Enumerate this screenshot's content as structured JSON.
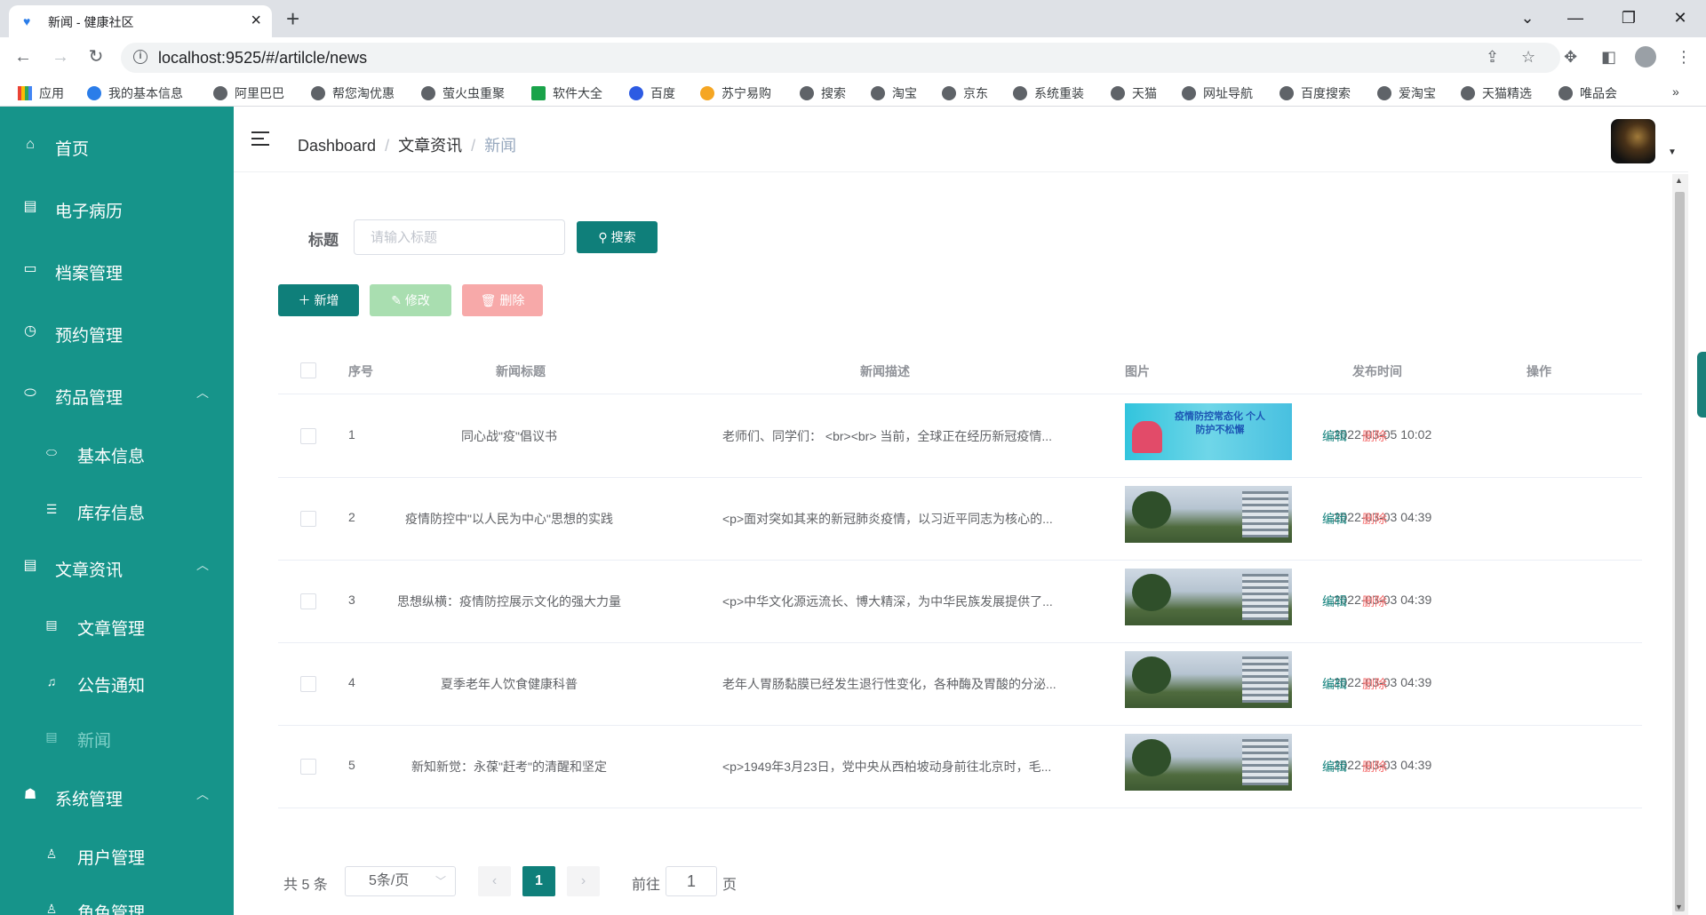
{
  "browser": {
    "tab_title": "新闻 - 健康社区",
    "url": "localhost:9525/#/artilcle/news",
    "bookmarks": [
      "应用",
      "我的基本信息",
      "阿里巴巴",
      "帮您淘优惠",
      "萤火虫重聚",
      "软件大全",
      "百度",
      "苏宁易购",
      "搜索",
      "淘宝",
      "京东",
      "系统重装",
      "天猫",
      "网址导航",
      "百度搜索",
      "爱淘宝",
      "天猫精选",
      "唯品会"
    ]
  },
  "sidebar": {
    "items": [
      {
        "label": "首页",
        "icon": "home-icon"
      },
      {
        "label": "电子病历",
        "icon": "record-icon"
      },
      {
        "label": "档案管理",
        "icon": "folder-icon"
      },
      {
        "label": "预约管理",
        "icon": "clock-icon"
      },
      {
        "label": "药品管理",
        "icon": "pill-icon"
      },
      {
        "label": "基本信息",
        "icon": "pill-icon"
      },
      {
        "label": "库存信息",
        "icon": "database-icon"
      },
      {
        "label": "文章资讯",
        "icon": "article-icon"
      },
      {
        "label": "文章管理",
        "icon": "document-icon"
      },
      {
        "label": "公告通知",
        "icon": "bell-icon"
      },
      {
        "label": "新闻",
        "icon": "document-icon"
      },
      {
        "label": "系统管理",
        "icon": "user-group-icon"
      },
      {
        "label": "用户管理",
        "icon": "user-icon"
      },
      {
        "label": "角色管理",
        "icon": "roles-icon"
      }
    ]
  },
  "header": {
    "breadcrumb": [
      "Dashboard",
      "文章资讯",
      "新闻"
    ]
  },
  "search": {
    "label": "标题",
    "placeholder": "请输入标题",
    "value": "",
    "button": "搜索"
  },
  "toolbar": {
    "add": "新增",
    "edit": "修改",
    "delete": "删除"
  },
  "table": {
    "columns": [
      "序号",
      "新闻标题",
      "新闻描述",
      "图片",
      "发布时间",
      "操作"
    ],
    "rows": [
      {
        "no": "1",
        "title": "同心战\"疫\"倡议书",
        "desc": "老师们、同学们： <br><br> 当前，全球正在经历新冠疫情...",
        "image_text": "疫情防控常态化 个人防护不松懈",
        "time": "2022-03-05 10:02"
      },
      {
        "no": "2",
        "title": "疫情防控中\"以人民为中心\"思想的实践",
        "desc": "<p>面对突如其来的新冠肺炎疫情，以习近平同志为核心的...",
        "image_text": "",
        "time": "2022-03-03 04:39"
      },
      {
        "no": "3",
        "title": "思想纵横：疫情防控展示文化的强大力量",
        "desc": "<p>中华文化源远流长、博大精深，为中华民族发展提供了...",
        "image_text": "",
        "time": "2022-03-03 04:39"
      },
      {
        "no": "4",
        "title": "夏季老年人饮食健康科普",
        "desc": "老年人胃肠黏膜已经发生退行性变化，各种酶及胃酸的分泌...",
        "image_text": "",
        "time": "2022-03-03 04:39"
      },
      {
        "no": "5",
        "title": "新知新觉：永葆\"赶考\"的清醒和坚定",
        "desc": "<p>1949年3月23日，党中央从西柏坡动身前往北京时，毛...",
        "image_text": "",
        "time": "2022-03-03 04:39"
      }
    ],
    "op_edit": "编辑",
    "op_delete": "删除"
  },
  "pagination": {
    "total": "共 5 条",
    "page_size": "5条/页",
    "current": "1",
    "goto_label": "前往",
    "goto_value": "1",
    "page_suffix": "页"
  },
  "colors": {
    "sidebar": "#16948a",
    "primary": "#0f7f7a",
    "danger": "#f56c6c"
  }
}
